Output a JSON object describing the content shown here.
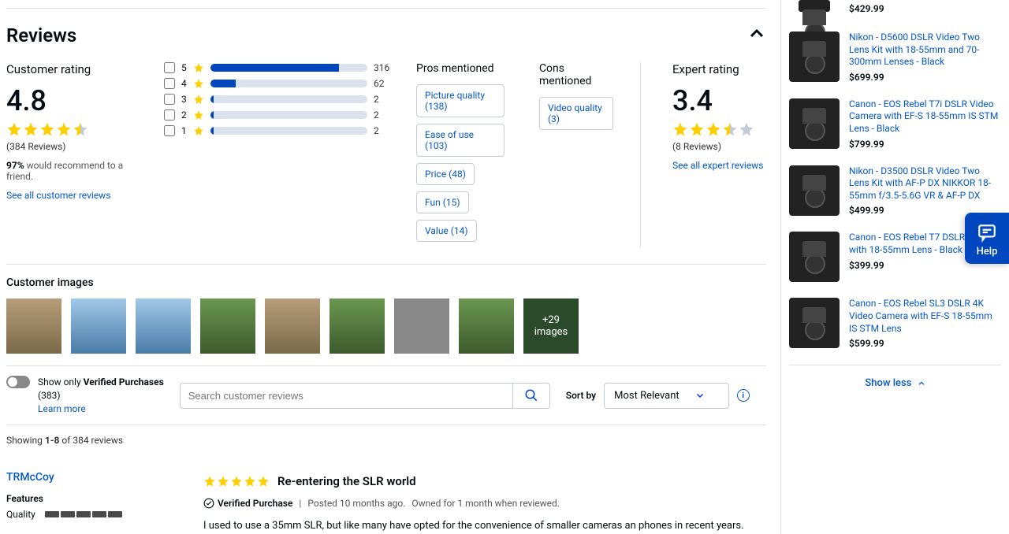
{
  "reviews": {
    "heading": "Reviews",
    "customer_rating_label": "Customer rating",
    "rating_value": "4.8",
    "rating_count": "(384 Reviews)",
    "recommend_pct": "97%",
    "recommend_text": "would recommend to a friend.",
    "see_all_reviews": "See all customer reviews",
    "histogram": [
      {
        "stars": "5",
        "count": "316",
        "pct": 82
      },
      {
        "stars": "4",
        "count": "62",
        "pct": 16
      },
      {
        "stars": "3",
        "count": "2",
        "pct": 2
      },
      {
        "stars": "2",
        "count": "2",
        "pct": 2
      },
      {
        "stars": "1",
        "count": "2",
        "pct": 2
      }
    ],
    "pros_label": "Pros mentioned",
    "pros": [
      {
        "label": "Picture quality (138)"
      },
      {
        "label": "Ease of use (103)"
      },
      {
        "label": "Price (48)"
      },
      {
        "label": "Fun (15)"
      },
      {
        "label": "Value (14)"
      }
    ],
    "cons_label": "Cons mentioned",
    "cons": [
      {
        "label": "Video quality (3)"
      }
    ],
    "expert_label": "Expert rating",
    "expert_value": "3.4",
    "expert_count": "(8 Reviews)",
    "see_expert": "See all expert reviews",
    "customer_images_label": "Customer images",
    "more_images_count": "+29",
    "more_images_text": "images",
    "verified_toggle_label": "Show only",
    "verified_toggle_bold": "Verified Purchases",
    "verified_toggle_count": "(383)",
    "learn_more": "Learn more",
    "search_placeholder": "Search customer reviews",
    "sort_by_label": "Sort by",
    "sort_value": "Most Relevant",
    "showing_prefix": "Showing ",
    "showing_range": "1-8",
    "showing_suffix": " of 384 reviews"
  },
  "review_item": {
    "author": "TRMcCoy",
    "features_label": "Features",
    "quality_label": "Quality",
    "title": "Re-entering the SLR world",
    "verified": "Verified Purchase",
    "posted": "Posted  10 months ago.",
    "owned": "Owned for 1 month when reviewed.",
    "body": "I used to use a 35mm SLR, but like many have opted for the convenience of smaller cameras an phones in recent years."
  },
  "sidebar": {
    "products": [
      {
        "name": "",
        "price": "$429.99"
      },
      {
        "name": "Nikon - D5600 DSLR Video Two Lens Kit with 18-55mm and 70-300mm Lenses - Black",
        "price": "$699.99"
      },
      {
        "name": "Canon - EOS Rebel T7i DSLR Video Camera with EF-S 18-55mm IS STM Lens - Black",
        "price": "$799.99"
      },
      {
        "name": "Nikon - D3500 DSLR Video Two Lens Kit with AF-P DX NIKKOR 18-55mm f/3.5-5.6G VR & AF-P DX",
        "price": "$499.99"
      },
      {
        "name": "Canon - EOS Rebel T7 DSLR Camera with 18-55mm Lens - Black",
        "price": "$399.99"
      },
      {
        "name": "Canon - EOS Rebel SL3 DSLR 4K Video Camera with EF-S 18-55mm IS STM Lens",
        "price": "$599.99"
      }
    ],
    "show_less": "Show less"
  },
  "help": "Help"
}
